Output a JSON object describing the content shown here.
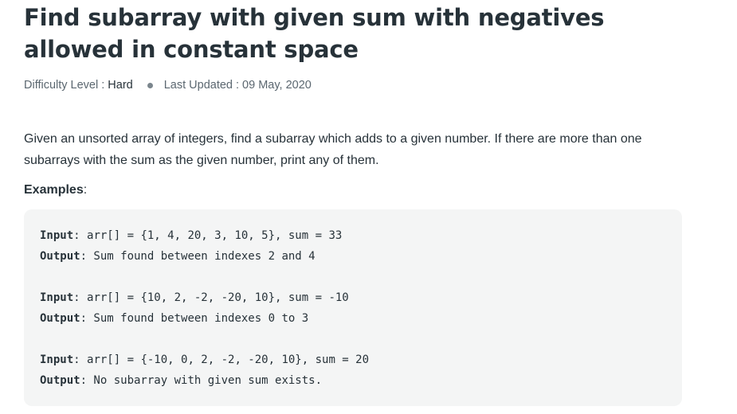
{
  "article": {
    "title": "Find subarray with given sum with negatives allowed in constant space",
    "difficulty_label": "Difficulty Level :",
    "difficulty_value": "Hard",
    "updated_label": "Last Updated :",
    "updated_value": "09 May, 2020",
    "intro": "Given an unsorted array of integers, find a subarray which adds to a given number. If there are more than one subarrays with the sum as the given number, print any of them.",
    "examples_label": "Examples",
    "examples_colon": ":"
  },
  "examples": [
    {
      "input_label": "Input",
      "input_text": ": arr[] = {1, 4, 20, 3, 10, 5}, sum = 33",
      "output_label": "Output",
      "output_text": ": Sum found between indexes 2 and 4"
    },
    {
      "input_label": "Input",
      "input_text": ": arr[] = {10, 2, -2, -20, 10}, sum = -10",
      "output_label": "Output",
      "output_text": ": Sum found between indexes 0 to 3"
    },
    {
      "input_label": "Input",
      "input_text": ": arr[] = {-10, 0, 2, -2, -20, 10}, sum = 20",
      "output_label": "Output",
      "output_text": ": No subarray with given sum exists."
    }
  ]
}
